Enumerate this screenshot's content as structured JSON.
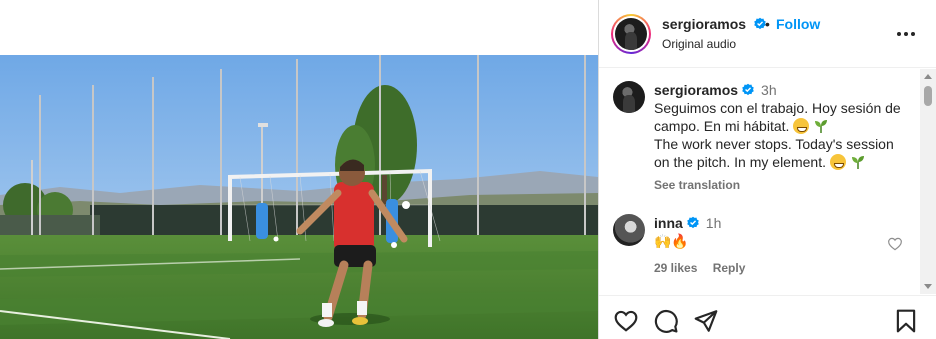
{
  "post": {
    "username": "sergioramos",
    "dot": "•",
    "follow_label": "Follow",
    "audio": "Original audio",
    "more_icon": "more-horizontal-icon"
  },
  "caption": {
    "username": "sergioramos",
    "time": "3h",
    "line1": "Seguimos con el trabajo. Hoy sesión de campo. En mi hábitat.",
    "line2": "The work never stops. Today's session on the pitch. In my element.",
    "see_translation": "See translation"
  },
  "comment": {
    "username": "inna",
    "time": "1h",
    "text": "🙌🔥",
    "likes": "29 likes",
    "reply": "Reply"
  },
  "actions": [
    "heart-icon",
    "comment-icon",
    "share-icon",
    "bookmark-icon"
  ],
  "colors": {
    "accent": "#0095f6",
    "verified": "#0095f6",
    "text": "#262626",
    "muted": "#737373"
  }
}
